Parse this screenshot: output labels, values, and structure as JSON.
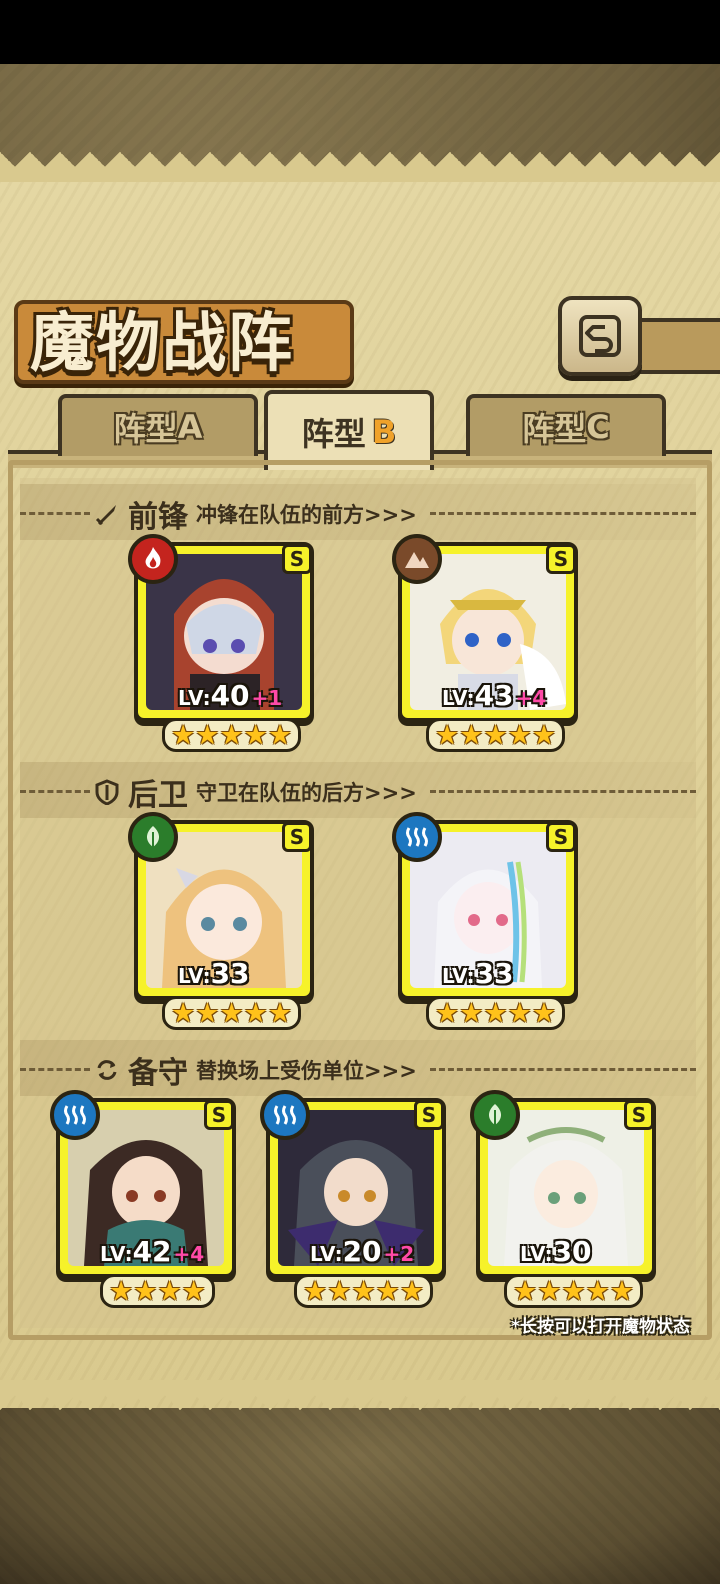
{
  "title": "魔物战阵",
  "tabs": [
    {
      "prefix": "阵型",
      "letter": "A",
      "active": false
    },
    {
      "prefix": "阵型",
      "letter": "B",
      "active": true
    },
    {
      "prefix": "阵型",
      "letter": "C",
      "active": false
    }
  ],
  "sections": {
    "front": {
      "name": "前锋",
      "desc": "冲锋在队伍的前方>>>",
      "icon": "sword-icon"
    },
    "rear": {
      "name": "后卫",
      "desc": "守卫在队伍的后方>>>",
      "icon": "shield-icon"
    },
    "reserve": {
      "name": "备守",
      "desc": "替换场上受伤单位>>>",
      "icon": "swap-icon"
    }
  },
  "units": {
    "front_1": {
      "element": "fire",
      "rank": "S",
      "lv_label": "LV:",
      "lv": "40",
      "plus": "+1",
      "stars": 5
    },
    "front_2": {
      "element": "earth",
      "rank": "S",
      "lv_label": "LV:",
      "lv": "43",
      "plus": "+4",
      "stars": 5
    },
    "rear_1": {
      "element": "wood",
      "rank": "S",
      "lv_label": "LV:",
      "lv": "33",
      "plus": "",
      "stars": 5
    },
    "rear_2": {
      "element": "water",
      "rank": "S",
      "lv_label": "LV:",
      "lv": "33",
      "plus": "",
      "stars": 5
    },
    "reserve_1": {
      "element": "water",
      "rank": "S",
      "lv_label": "LV:",
      "lv": "42",
      "plus": "+4",
      "stars": 4
    },
    "reserve_2": {
      "element": "water",
      "rank": "S",
      "lv_label": "LV:",
      "lv": "20",
      "plus": "+2",
      "stars": 5
    },
    "reserve_3": {
      "element": "wood",
      "rank": "S",
      "lv_label": "LV:",
      "lv": "30",
      "plus": "",
      "stars": 5
    }
  },
  "hint": "*长按可以打开魔物状态",
  "colors": {
    "panel": "#d9c98e",
    "card_border": "#f6f22a",
    "fire": "#c4241e",
    "earth": "#7a4a2a",
    "wood": "#2b7d2b",
    "water": "#1d77c0",
    "plus": "#ff4aa8"
  }
}
